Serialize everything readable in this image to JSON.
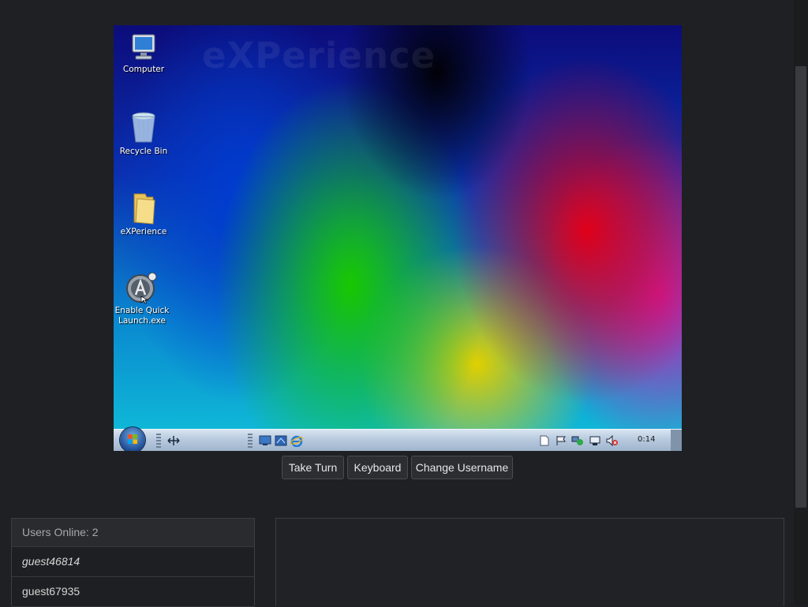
{
  "vm": {
    "wallpaper_title": "eXPerience",
    "desktop_icons": [
      {
        "label": "Computer",
        "icon": "computer-icon"
      },
      {
        "label": "Recycle Bin",
        "icon": "recycle-bin-icon"
      },
      {
        "label": "eXPerience",
        "icon": "folder-icon"
      },
      {
        "label": "Enable Quick Launch.exe",
        "icon": "quick-launch-app-icon"
      }
    ],
    "taskbar": {
      "clock": "0:14"
    }
  },
  "controls": {
    "take_turn": "Take Turn",
    "keyboard": "Keyboard",
    "change_username": "Change Username"
  },
  "users": {
    "header": "Users Online: 2",
    "list": [
      "guest46814",
      "guest67935"
    ]
  },
  "colors": {
    "page_bg": "#1f2023",
    "button_bg": "#2d2e31",
    "panel_border": "#3d3e42"
  }
}
